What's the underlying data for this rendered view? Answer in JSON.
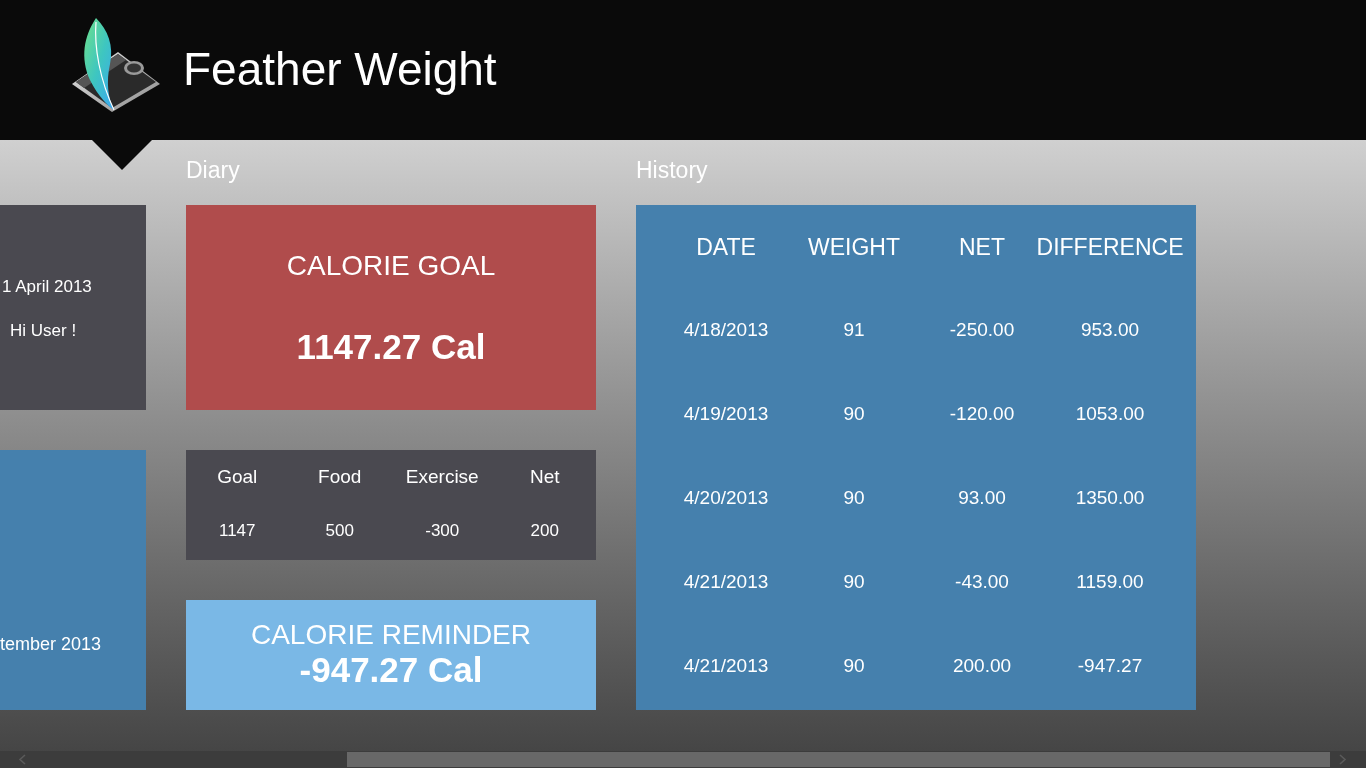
{
  "header": {
    "title": "Feather Weight"
  },
  "profile_tile": {
    "date": "1 April 2013",
    "greeting": "Hi User !"
  },
  "period_tile": {
    "text": "tember 2013"
  },
  "diary": {
    "heading": "Diary",
    "calorie_goal": {
      "label": "CALORIE GOAL",
      "value": "1147.27 Cal"
    },
    "summary": {
      "columns": [
        "Goal",
        "Food",
        "Exercise",
        "Net"
      ],
      "values": [
        "1147",
        "500",
        "-300",
        "200"
      ]
    },
    "calorie_reminder": {
      "label": "CALORIE REMINDER",
      "value": "-947.27 Cal"
    }
  },
  "history": {
    "heading": "History",
    "columns": [
      "DATE",
      "WEIGHT",
      "NET",
      "DIFFERENCE"
    ],
    "rows": [
      [
        "4/18/2013",
        "91",
        "-250.00",
        "953.00"
      ],
      [
        "4/19/2013",
        "90",
        "-120.00",
        "1053.00"
      ],
      [
        "4/20/2013",
        "90",
        "93.00",
        "1350.00"
      ],
      [
        "4/21/2013",
        "90",
        "-43.00",
        "1159.00"
      ],
      [
        "4/21/2013",
        "90",
        "200.00",
        "-947.27"
      ]
    ]
  }
}
